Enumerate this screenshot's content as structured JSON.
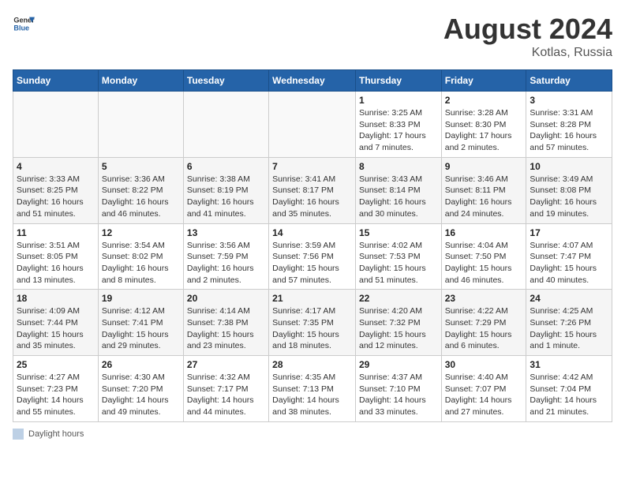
{
  "header": {
    "logo_general": "General",
    "logo_blue": "Blue",
    "main_title": "August 2024",
    "sub_title": "Kotlas, Russia"
  },
  "days_of_week": [
    "Sunday",
    "Monday",
    "Tuesday",
    "Wednesday",
    "Thursday",
    "Friday",
    "Saturday"
  ],
  "legend_label": "Daylight hours",
  "weeks": [
    [
      {
        "day": "",
        "info": ""
      },
      {
        "day": "",
        "info": ""
      },
      {
        "day": "",
        "info": ""
      },
      {
        "day": "",
        "info": ""
      },
      {
        "day": "1",
        "info": "Sunrise: 3:25 AM\nSunset: 8:33 PM\nDaylight: 17 hours\nand 7 minutes."
      },
      {
        "day": "2",
        "info": "Sunrise: 3:28 AM\nSunset: 8:30 PM\nDaylight: 17 hours\nand 2 minutes."
      },
      {
        "day": "3",
        "info": "Sunrise: 3:31 AM\nSunset: 8:28 PM\nDaylight: 16 hours\nand 57 minutes."
      }
    ],
    [
      {
        "day": "4",
        "info": "Sunrise: 3:33 AM\nSunset: 8:25 PM\nDaylight: 16 hours\nand 51 minutes."
      },
      {
        "day": "5",
        "info": "Sunrise: 3:36 AM\nSunset: 8:22 PM\nDaylight: 16 hours\nand 46 minutes."
      },
      {
        "day": "6",
        "info": "Sunrise: 3:38 AM\nSunset: 8:19 PM\nDaylight: 16 hours\nand 41 minutes."
      },
      {
        "day": "7",
        "info": "Sunrise: 3:41 AM\nSunset: 8:17 PM\nDaylight: 16 hours\nand 35 minutes."
      },
      {
        "day": "8",
        "info": "Sunrise: 3:43 AM\nSunset: 8:14 PM\nDaylight: 16 hours\nand 30 minutes."
      },
      {
        "day": "9",
        "info": "Sunrise: 3:46 AM\nSunset: 8:11 PM\nDaylight: 16 hours\nand 24 minutes."
      },
      {
        "day": "10",
        "info": "Sunrise: 3:49 AM\nSunset: 8:08 PM\nDaylight: 16 hours\nand 19 minutes."
      }
    ],
    [
      {
        "day": "11",
        "info": "Sunrise: 3:51 AM\nSunset: 8:05 PM\nDaylight: 16 hours\nand 13 minutes."
      },
      {
        "day": "12",
        "info": "Sunrise: 3:54 AM\nSunset: 8:02 PM\nDaylight: 16 hours\nand 8 minutes."
      },
      {
        "day": "13",
        "info": "Sunrise: 3:56 AM\nSunset: 7:59 PM\nDaylight: 16 hours\nand 2 minutes."
      },
      {
        "day": "14",
        "info": "Sunrise: 3:59 AM\nSunset: 7:56 PM\nDaylight: 15 hours\nand 57 minutes."
      },
      {
        "day": "15",
        "info": "Sunrise: 4:02 AM\nSunset: 7:53 PM\nDaylight: 15 hours\nand 51 minutes."
      },
      {
        "day": "16",
        "info": "Sunrise: 4:04 AM\nSunset: 7:50 PM\nDaylight: 15 hours\nand 46 minutes."
      },
      {
        "day": "17",
        "info": "Sunrise: 4:07 AM\nSunset: 7:47 PM\nDaylight: 15 hours\nand 40 minutes."
      }
    ],
    [
      {
        "day": "18",
        "info": "Sunrise: 4:09 AM\nSunset: 7:44 PM\nDaylight: 15 hours\nand 35 minutes."
      },
      {
        "day": "19",
        "info": "Sunrise: 4:12 AM\nSunset: 7:41 PM\nDaylight: 15 hours\nand 29 minutes."
      },
      {
        "day": "20",
        "info": "Sunrise: 4:14 AM\nSunset: 7:38 PM\nDaylight: 15 hours\nand 23 minutes."
      },
      {
        "day": "21",
        "info": "Sunrise: 4:17 AM\nSunset: 7:35 PM\nDaylight: 15 hours\nand 18 minutes."
      },
      {
        "day": "22",
        "info": "Sunrise: 4:20 AM\nSunset: 7:32 PM\nDaylight: 15 hours\nand 12 minutes."
      },
      {
        "day": "23",
        "info": "Sunrise: 4:22 AM\nSunset: 7:29 PM\nDaylight: 15 hours\nand 6 minutes."
      },
      {
        "day": "24",
        "info": "Sunrise: 4:25 AM\nSunset: 7:26 PM\nDaylight: 15 hours\nand 1 minute."
      }
    ],
    [
      {
        "day": "25",
        "info": "Sunrise: 4:27 AM\nSunset: 7:23 PM\nDaylight: 14 hours\nand 55 minutes."
      },
      {
        "day": "26",
        "info": "Sunrise: 4:30 AM\nSunset: 7:20 PM\nDaylight: 14 hours\nand 49 minutes."
      },
      {
        "day": "27",
        "info": "Sunrise: 4:32 AM\nSunset: 7:17 PM\nDaylight: 14 hours\nand 44 minutes."
      },
      {
        "day": "28",
        "info": "Sunrise: 4:35 AM\nSunset: 7:13 PM\nDaylight: 14 hours\nand 38 minutes."
      },
      {
        "day": "29",
        "info": "Sunrise: 4:37 AM\nSunset: 7:10 PM\nDaylight: 14 hours\nand 33 minutes."
      },
      {
        "day": "30",
        "info": "Sunrise: 4:40 AM\nSunset: 7:07 PM\nDaylight: 14 hours\nand 27 minutes."
      },
      {
        "day": "31",
        "info": "Sunrise: 4:42 AM\nSunset: 7:04 PM\nDaylight: 14 hours\nand 21 minutes."
      }
    ]
  ]
}
